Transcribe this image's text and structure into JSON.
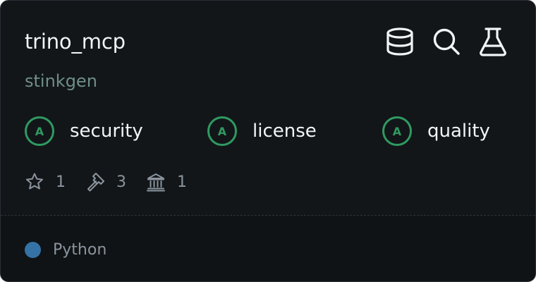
{
  "repo": {
    "name": "trino_mcp",
    "owner": "stinkgen"
  },
  "header_icons": [
    "database-icon",
    "search-icon",
    "flask-icon"
  ],
  "grades": [
    {
      "letter": "A",
      "label": "security"
    },
    {
      "letter": "A",
      "label": "license"
    },
    {
      "letter": "A",
      "label": "quality"
    }
  ],
  "stats": {
    "stars": "1",
    "tools": "3",
    "institutions": "1"
  },
  "language": {
    "name": "Python",
    "color": "#3572A5"
  },
  "colors": {
    "background": "#121619",
    "accent_green": "#2f9a61",
    "owner_text": "#6f8f86"
  }
}
